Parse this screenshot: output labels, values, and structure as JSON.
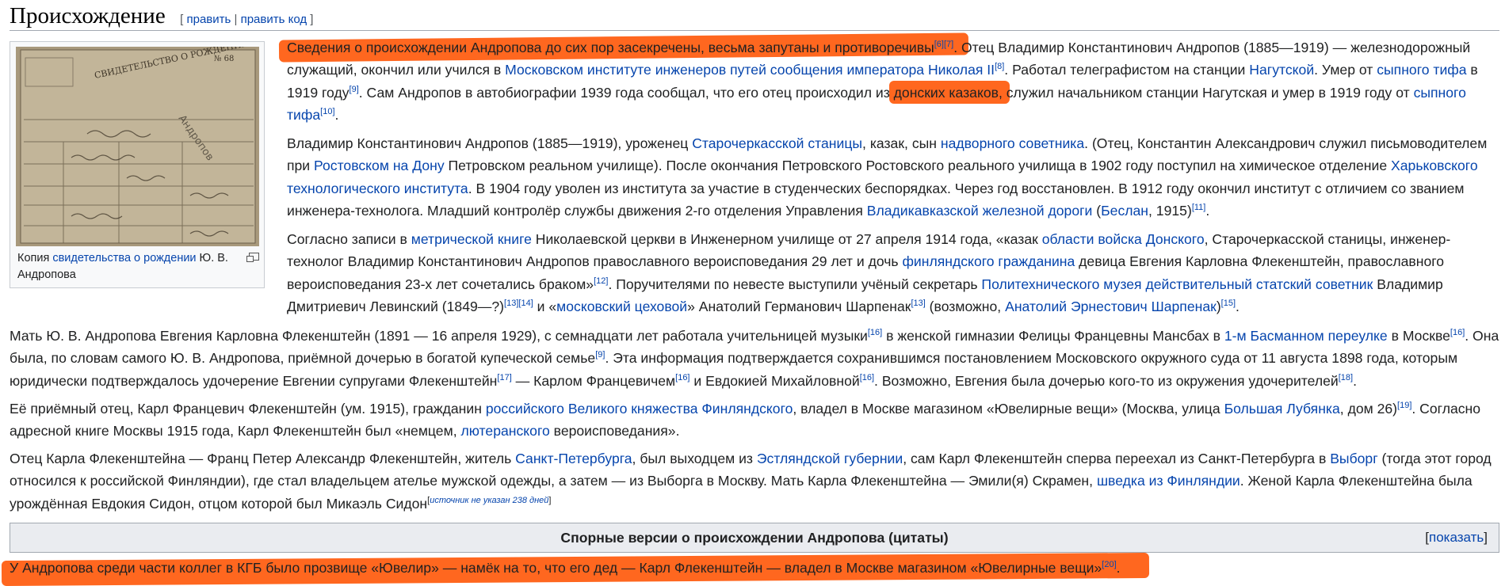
{
  "section": {
    "title": "Происхождение",
    "edit": {
      "open": "[",
      "edit_label": "править",
      "sep": "|",
      "edit_code_label": "править код",
      "close": "]"
    }
  },
  "thumb": {
    "caption": {
      "pre": "Копия ",
      "link": "свидетельства о рождении",
      "post": " Ю. В. Андропова"
    },
    "doc_text": {
      "header": "СВИДЕТЕЛЬСТВО О РОЖДЕНИИ",
      "number": "№ 68",
      "stamp": "Андропов"
    }
  },
  "p1": {
    "t1": "Сведения о происхождении Андропова до сих пор засекречены, весьма запутаны и противоречивы",
    "r1": "[6]",
    "r2": "[7]",
    "t2": ". Отец Владимир Константинович Андропов (1885—1919) — железнодорожный служащий, окончил или учился в ",
    "l1": "Московском институте инженеров путей сообщения императора Николая II",
    "r3": "[8]",
    "t3": ". Работал телеграфистом на станции ",
    "l2": "Нагутской",
    "t4": ". Умер от ",
    "l3": "сыпного тифа",
    "t5": " в 1919 году",
    "r4": "[9]",
    "t6": ". Сам Андропов в автобиографии 1939 года сообщал, что его отец происходил из ",
    "t7": "донских казаков",
    "t8": ", служил начальником станции Нагутская и умер в 1919 году от ",
    "l4": "сыпного тифа",
    "r5": "[10]",
    "t9": "."
  },
  "p2": {
    "t1": "Владимир Константинович Андропов (1885—1919), уроженец ",
    "l1": "Старочеркасской станицы",
    "t2": ", казак, сын ",
    "l2": "надворного советника",
    "t3": ". (Отец, Константин Александрович служил письмоводителем при ",
    "l3": "Ростовском на Дону",
    "t4": " Петровском реальном училище). После окончания Петровского Ростовского реального училища в 1902 году поступил на химическое отделение ",
    "l4": "Харьковского технологического института",
    "t5": ". В 1904 году уволен из института за участие в студенческих беспорядках. Через год восстановлен. В 1912 году окончил институт с отличием со званием инженера-технолога. Младший контролёр службы движения 2-го отделения Управления ",
    "l5": "Владикавказской железной дороги",
    "t6": " (",
    "l6": "Беслан",
    "t7": ", 1915)",
    "r1": "[11]",
    "t8": "."
  },
  "p3": {
    "t1": "Согласно записи в ",
    "l1": "метрической книге",
    "t2": " Николаевской церкви в Инженерном училище от 27 апреля 1914 года, «казак ",
    "l2": "области войска Донского",
    "t3": ", Старочеркасской станицы, инженер-технолог Владимир Константинович Андропов православного вероисповедания 29 лет и дочь ",
    "l3": "финляндского гражданина",
    "t4": " девица Евгения Карловна Флекенштейн, православного вероисповедания 23-х лет сочетались браком»",
    "r1": "[12]",
    "t5": ". Поручителями по невесте выступили учёный секретарь ",
    "l4": "Политехнического музея действительный статский советник",
    "t6": " Владимир Дмитриевич Левинский (1849—?)",
    "r2": "[13]",
    "r3": "[14]",
    "t7": " и «",
    "l5": "московский цеховой",
    "t8": "» Анатолий Германович Шарпенак",
    "r4": "[13]",
    "t9": " (возможно, ",
    "l6": "Анатолий Эрнестович Шарпенак",
    "t10": ")",
    "r5": "[15]",
    "t11": "."
  },
  "p4": {
    "t1": "Мать Ю. В. Андропова Евгения Карловна Флекенштейн (1891 — 16 апреля 1929), с семнадцати лет работала учительницей музыки",
    "r1": "[16]",
    "t2": " в женской гимназии Фелицы Францевны Мансбах в ",
    "l1": "1-м Басманном переулке",
    "t3": " в Москве",
    "r2": "[16]",
    "t4": ". Она была, по словам самого Ю. В. Андропова, приёмной дочерью в богатой купеческой семье",
    "r3": "[9]",
    "t5": ". Эта информация подтверждается сохранившимся постановлением Московского окружного суда от 11 августа 1898 года, которым юридически подтверждалось удочерение Евгении супругами Флекенштейн",
    "r4": "[17]",
    "t6": " — Карлом Францевичем",
    "r5": "[16]",
    "t7": " и Евдокией Михайловной",
    "r6": "[16]",
    "t8": ". Возможно, Евгения была дочерью кого-то из окружения удочерителей",
    "r7": "[18]",
    "t9": "."
  },
  "p5": {
    "t1": "Её приёмный отец, Карл Францевич Флекенштейн (ум. 1915), гражданин ",
    "l1": "российского Великого княжества Финляндского",
    "t2": ", владел в Москве магазином «Ювелирные вещи» (Москва, улица ",
    "l2": "Большая Лубянка",
    "t3": ", дом 26)",
    "r1": "[19]",
    "t4": ". Согласно адресной книге Москвы 1915 года, Карл Флекенштейн был «немцем, ",
    "l3": "лютеранского",
    "t5": " вероисповедания»."
  },
  "p6": {
    "t1": "Отец Карла Флекенштейна — Франц Петер Александр Флекенштейн, житель ",
    "l1": "Санкт-Петербурга",
    "t2": ", был выходцем из ",
    "l2": "Эстляндской губернии",
    "t3": ", сам Карл Флекенштейн сперва переехал из Санкт-Петербурга в ",
    "l3": "Выборг",
    "t4": " (тогда этот город относился к российской Финляндии), где стал владельцем ателье мужской одежды, а затем — из Выборга в Москву. Мать Карла Флекенштейна — Эмили(я) Скрамен, ",
    "l4": "шведка из Финляндии",
    "t5": ". Женой Карла Флекенштейна была урождённая Евдокия Сидон, отцом которой был Микаэль Сидон",
    "sn_open": "[",
    "sn": "источник не указан 238 дней",
    "sn_close": "]",
    "t6": ""
  },
  "navbox": {
    "title": "Спорные версии о происхождении Андропова (цитаты)",
    "toggle_open": "[",
    "toggle": "показать",
    "toggle_close": "]"
  },
  "p7": {
    "t1": "У Андропова среди части коллег в КГБ было прозвище «Ювелир» — намёк на то, что его дед — Карл Флекенштейн — владел в Москве магазином «Ювелирные вещи»",
    "r1": "[20]",
    "t2": "."
  },
  "colors": {
    "link": "#0645ad",
    "highlight": "#ff5a0c",
    "text": "#202122"
  }
}
